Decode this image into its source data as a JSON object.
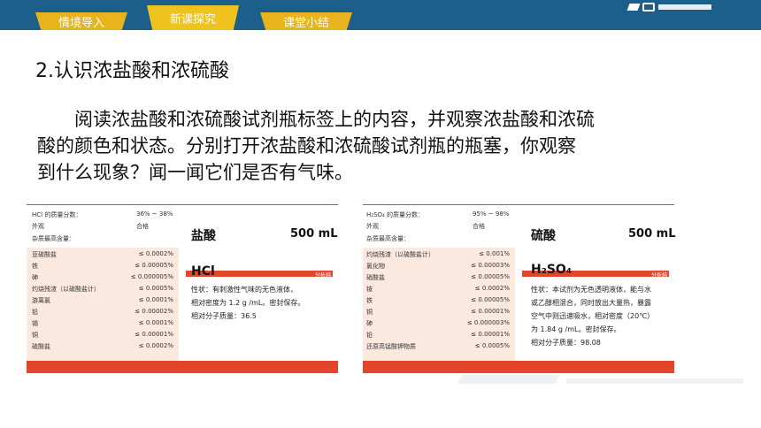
{
  "nav": {
    "tabs": [
      {
        "label": "情境导入"
      },
      {
        "label": "新课探究"
      },
      {
        "label": "课堂小结"
      }
    ],
    "active_tab": "新课探究"
  },
  "content": {
    "title": "2.认识浓盐酸和浓硫酸",
    "paragraph_lines": [
      "阅读浓盐酸和浓硫酸试剂瓶标签上的内容，并观察浓盐酸和浓硫",
      "酸的颜色和状态。分别打开浓盐酸和浓硫酸试剂瓶的瓶塞，你观察",
      "到什么现象？闻一闻它们是否有气味。"
    ]
  },
  "labels": [
    {
      "mass_fraction_label": "HCl 的质量分数：",
      "mass_fraction_value": "36% ~ 38%",
      "appearance_label": "外观",
      "appearance_value": "合格",
      "impurity_header": "杂质最高含量：",
      "impurities": [
        {
          "name": "亚硫酸盐",
          "value": "≤ 0.0002%"
        },
        {
          "name": "铁",
          "value": "≤ 0.00005%"
        },
        {
          "name": "砷",
          "value": "≤ 0.000005%"
        },
        {
          "name": "灼烧残渣（以硫酸盐计）",
          "value": "≤ 0.0005%"
        },
        {
          "name": "游离氯",
          "value": "≤ 0.0001%"
        },
        {
          "name": "铅",
          "value": "≤ 0.00002%"
        },
        {
          "name": "锡",
          "value": "≤ 0.0001%"
        },
        {
          "name": "铜",
          "value": "≤ 0.00001%"
        },
        {
          "name": "硫酸盐",
          "value": "≤ 0.0002%"
        }
      ],
      "chem_name": "盐酸",
      "volume": "500 mL",
      "tag": "分析纯",
      "formula": "HCl",
      "desc_lines": [
        "性状：有刺激性气味的无色液体，",
        "相对密度为 1.2 g /mL。密封保存。",
        "相对分子质量：36.5"
      ]
    },
    {
      "mass_fraction_label": "H₂SO₄ 的质量分数：",
      "mass_fraction_value": "95% ~ 98%",
      "appearance_label": "外观",
      "appearance_value": "合格",
      "impurity_header": "杂质最高含量：",
      "impurities": [
        {
          "name": "灼烧残渣（以硫酸盐计）",
          "value": "≤ 0.001%"
        },
        {
          "name": "氯化物",
          "value": "≤ 0.00003%"
        },
        {
          "name": "硝酸盐",
          "value": "≤ 0.00005%"
        },
        {
          "name": "铵",
          "value": "≤ 0.0002%"
        },
        {
          "name": "铁",
          "value": "≤ 0.00005%"
        },
        {
          "name": "铜",
          "value": "≤ 0.00001%"
        },
        {
          "name": "砷",
          "value": "≤ 0.000003%"
        },
        {
          "name": "铅",
          "value": "≤ 0.00001%"
        },
        {
          "name": "还原高锰酸钾物质",
          "value": "≤ 0.0005%"
        }
      ],
      "chem_name": "硫酸",
      "volume": "500 mL",
      "tag": "分析纯",
      "formula": "H₂SO₄",
      "desc_lines": [
        "性状：本试剂为无色透明液体，能与水",
        "或乙醇相混合，同时放出大量热，暴露",
        "空气中则迅速吸水，相对密度（20℃）",
        "为 1.84 g /mL。密封保存。",
        "相对分子质量：98.08"
      ]
    }
  ],
  "colors": {
    "nav_bar": "#1b5f8a",
    "tab": "#e8b31c",
    "label_red": "#e3452b",
    "label_peach": "#fbe4d7"
  }
}
